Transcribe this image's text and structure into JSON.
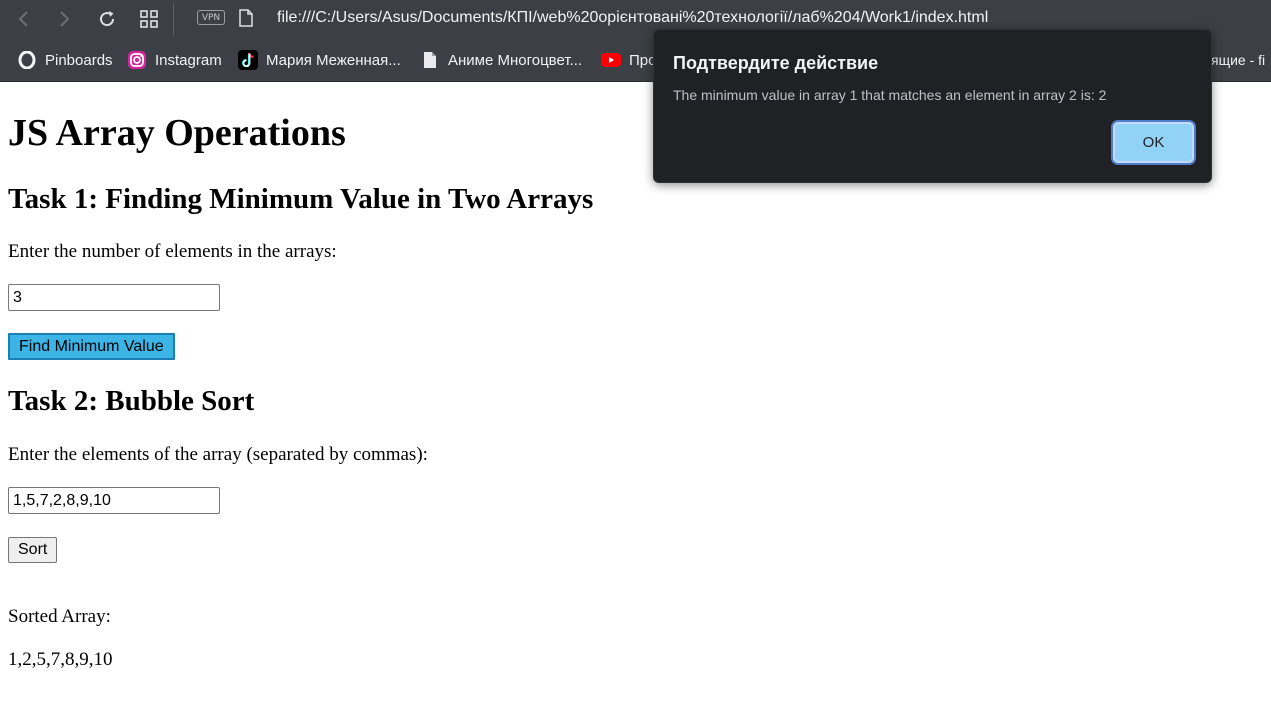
{
  "browser": {
    "vpn_label": "VPN",
    "url": "file:///C:/Users/Asus/Documents/КПІ/web%20орієнтовані%20технології/лаб%204/Work1/index.html",
    "bookmarks": [
      {
        "label": "Pinboards",
        "icon": "opera-icon"
      },
      {
        "label": "Instagram",
        "icon": "instagram-icon"
      },
      {
        "label": "Мария Меженная...",
        "icon": "tiktok-icon"
      },
      {
        "label": "Аниме Многоцвет...",
        "icon": "page-icon"
      },
      {
        "label": "Про",
        "icon": "youtube-icon"
      }
    ],
    "bookmark_overflow": "ящие - fi"
  },
  "page": {
    "title": "JS Array Operations",
    "task1": {
      "heading": "Task 1: Finding Minimum Value in Two Arrays",
      "prompt": "Enter the number of elements in the arrays:",
      "input_value": "3",
      "button_label": "Find Minimum Value"
    },
    "task2": {
      "heading": "Task 2: Bubble Sort",
      "prompt": "Enter the elements of the array (separated by commas):",
      "input_value": "1,5,7,2,8,9,10",
      "button_label": "Sort",
      "result_label": "Sorted Array:",
      "result_value": "1,2,5,7,8,9,10"
    }
  },
  "dialog": {
    "title": "Подтвердите действие",
    "message": "The minimum value in array 1 that matches an element in array 2 is: 2",
    "ok_label": "OK"
  },
  "colors": {
    "chrome_bg": "#3c3f45",
    "primary_button": "#3cb4e6",
    "dialog_bg": "#202124",
    "dialog_ok": "#93d2f7"
  }
}
